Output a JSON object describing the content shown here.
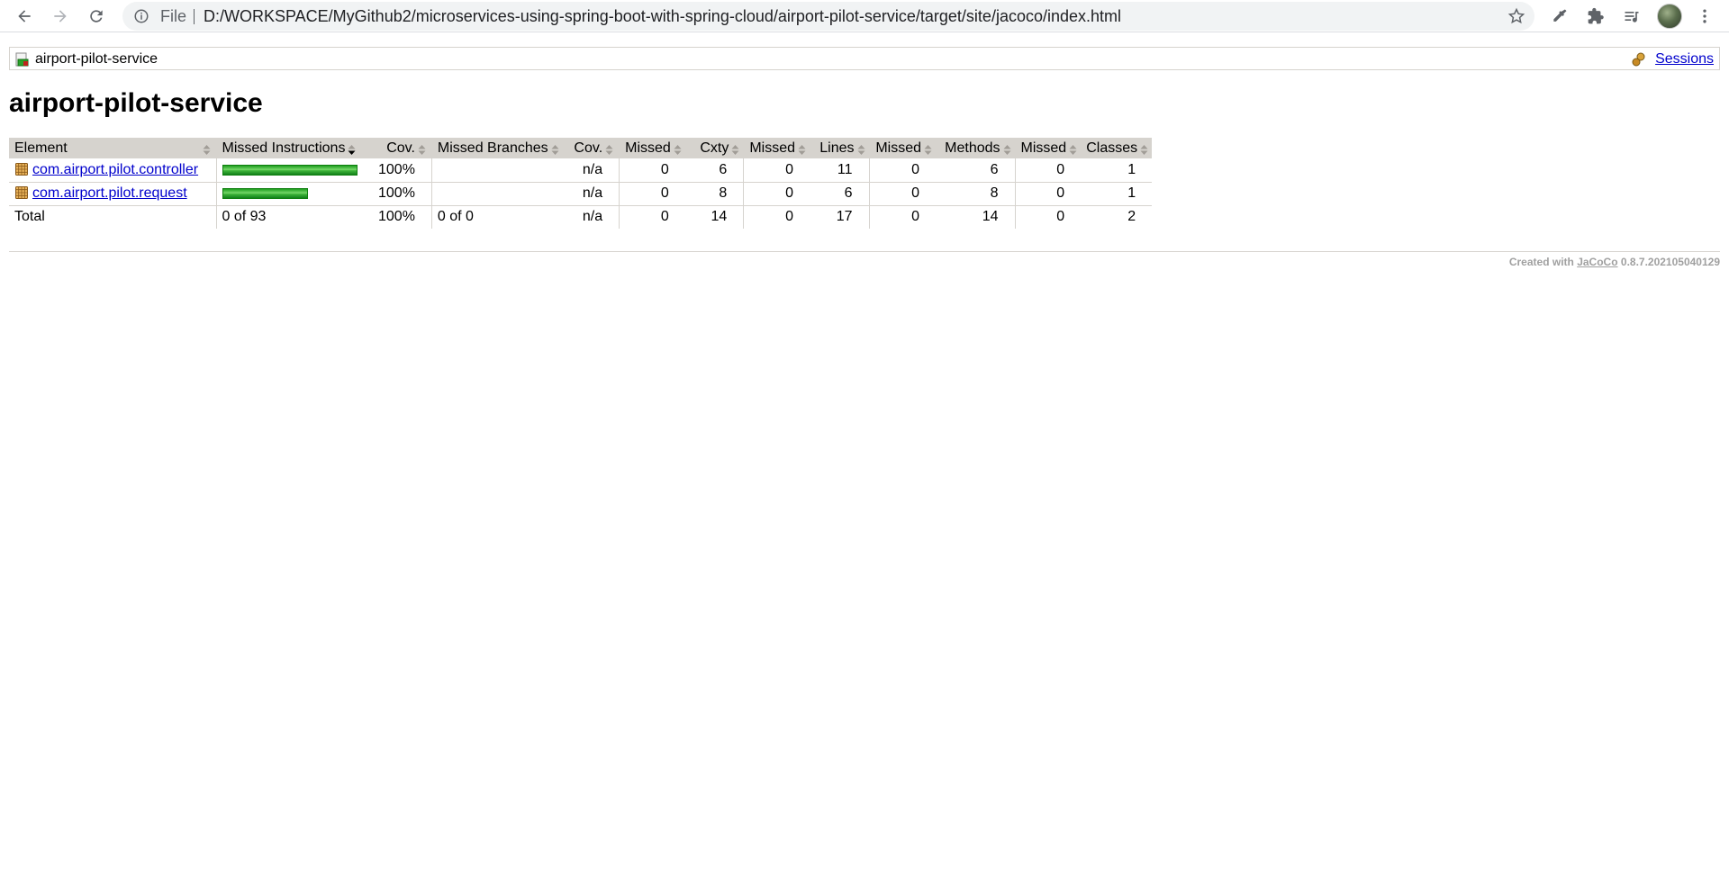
{
  "browser": {
    "file_label": "File",
    "url": "D:/WORKSPACE/MyGithub2/microservices-using-spring-boot-with-spring-cloud/airport-pilot-service/target/site/jacoco/index.html"
  },
  "breadcrumb": {
    "label": "airport-pilot-service",
    "sessions_label": "Sessions"
  },
  "page_title": "airport-pilot-service",
  "table": {
    "headers": [
      "Element",
      "Missed Instructions",
      "Cov.",
      "Missed Branches",
      "Cov.",
      "Missed",
      "Cxty",
      "Missed",
      "Lines",
      "Missed",
      "Methods",
      "Missed",
      "Classes"
    ],
    "rows": [
      {
        "element": "com.airport.pilot.controller",
        "missed_instructions_bar_fraction": 1.0,
        "cov": "100%",
        "missed_branches": "",
        "branch_cov": "n/a",
        "missed_cxty": "0",
        "cxty": "6",
        "missed_lines": "0",
        "lines": "11",
        "missed_methods": "0",
        "methods": "6",
        "missed_classes": "0",
        "classes": "1"
      },
      {
        "element": "com.airport.pilot.request",
        "missed_instructions_bar_fraction": 0.63,
        "cov": "100%",
        "missed_branches": "",
        "branch_cov": "n/a",
        "missed_cxty": "0",
        "cxty": "8",
        "missed_lines": "0",
        "lines": "6",
        "missed_methods": "0",
        "methods": "8",
        "missed_classes": "0",
        "classes": "1"
      }
    ],
    "total": {
      "element": "Total",
      "missed_instructions": "0 of 93",
      "cov": "100%",
      "missed_branches": "0 of 0",
      "branch_cov": "n/a",
      "missed_cxty": "0",
      "cxty": "14",
      "missed_lines": "0",
      "lines": "17",
      "missed_methods": "0",
      "methods": "14",
      "missed_classes": "0",
      "classes": "2"
    }
  },
  "footer": {
    "prefix": "Created with",
    "link": "JaCoCo",
    "version": "0.8.7.202105040129"
  }
}
